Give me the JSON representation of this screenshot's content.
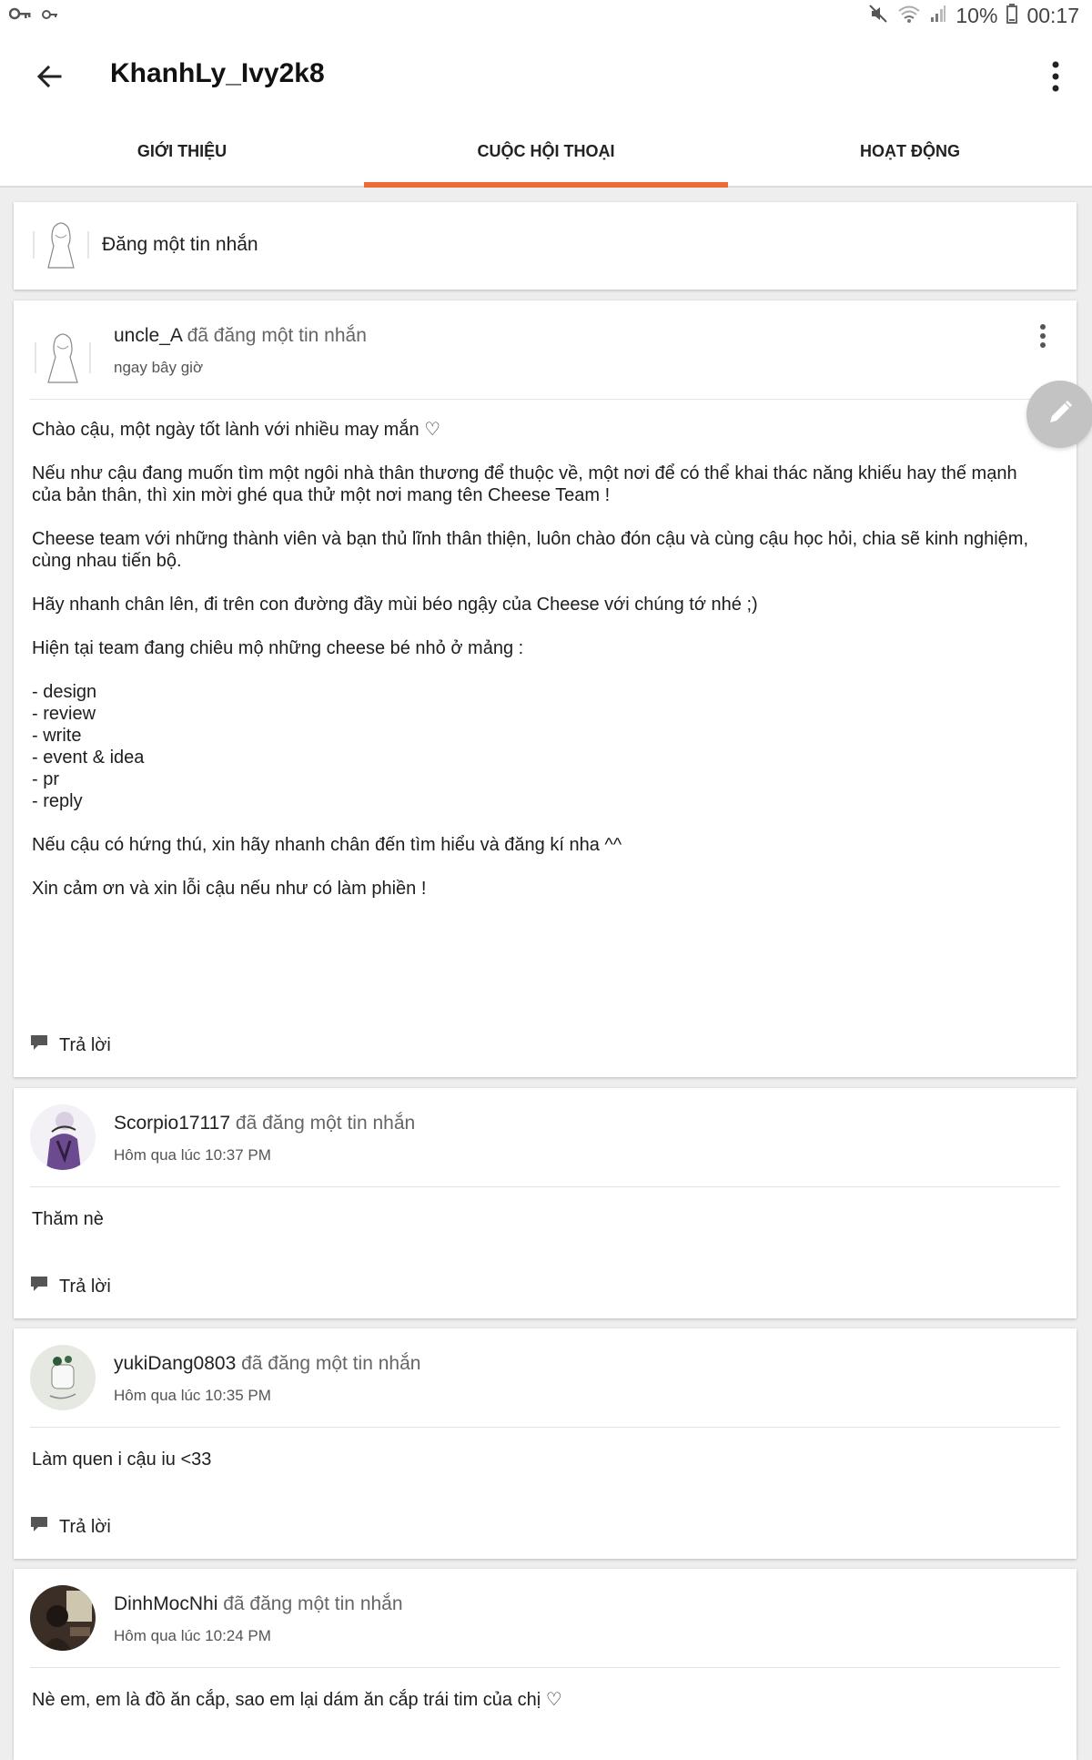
{
  "status_bar": {
    "battery": "10%",
    "time": "00:17"
  },
  "app_bar": {
    "title": "KhanhLy_Ivy2k8"
  },
  "tabs": [
    {
      "label": "GIỚI THIỆU"
    },
    {
      "label": "CUỘC HỘI THOẠI"
    },
    {
      "label": "HOẠT ĐỘNG"
    }
  ],
  "composer": {
    "label": "Đăng một tin nhắn"
  },
  "posts": [
    {
      "author": "uncle_A",
      "verb": "đã đăng một tin nhắn",
      "time": "ngay bây giờ",
      "body": "Chào cậu, một ngày tốt lành với nhiều may mắn ♡\n\nNếu như cậu đang muốn tìm một ngôi nhà thân thương để thuộc về, một nơi để có thể khai thác năng khiếu hay thế mạnh của bản thân, thì xin mời ghé qua thử một nơi mang tên Cheese Team !\n\nCheese team với những thành viên và bạn thủ lĩnh thân thiện, luôn chào đón cậu và cùng cậu học hỏi, chia sẽ kinh nghiệm, cùng nhau tiến bộ.\n\nHãy nhanh chân lên, đi trên con đường đầy mùi béo ngậy của Cheese với chúng tớ nhé ;)\n\nHiện tại team đang chiêu mộ những cheese bé nhỏ ở mảng :\n\n- design\n- review\n- write\n- event & idea\n- pr\n- reply\n\nNếu cậu có hứng thú, xin hãy nhanh chân đến tìm hiểu và đăng kí nha ^^\n\nXin cảm ơn và xin lỗi cậu nếu như có làm phiền !",
      "reply_label": "Trả lời"
    },
    {
      "author": "Scorpio17117",
      "verb": "đã đăng một tin nhắn",
      "time": "Hôm qua lúc 10:37 PM",
      "body": "Thăm nè",
      "reply_label": "Trả lời"
    },
    {
      "author": "yukiDang0803",
      "verb": "đã đăng một tin nhắn",
      "time": "Hôm qua lúc 10:35 PM",
      "body": "Làm quen i cậu iu <33",
      "reply_label": "Trả lời"
    },
    {
      "author": "DinhMocNhi",
      "verb": "đã đăng một tin nhắn",
      "time": "Hôm qua lúc 10:24 PM",
      "body": "Nè em, em là đồ ăn cắp, sao em lại dám ăn cắp trái tim của chị ♡",
      "reply_label": ""
    }
  ],
  "colors": {
    "accent": "#ec6a37",
    "fab": "#c3c3c3"
  },
  "icons": [
    "key-icon",
    "key-small-icon",
    "mute-icon",
    "wifi-icon",
    "signal-icon",
    "battery-icon",
    "back-arrow-icon",
    "more-vert-icon",
    "comment-icon",
    "pencil-icon"
  ]
}
